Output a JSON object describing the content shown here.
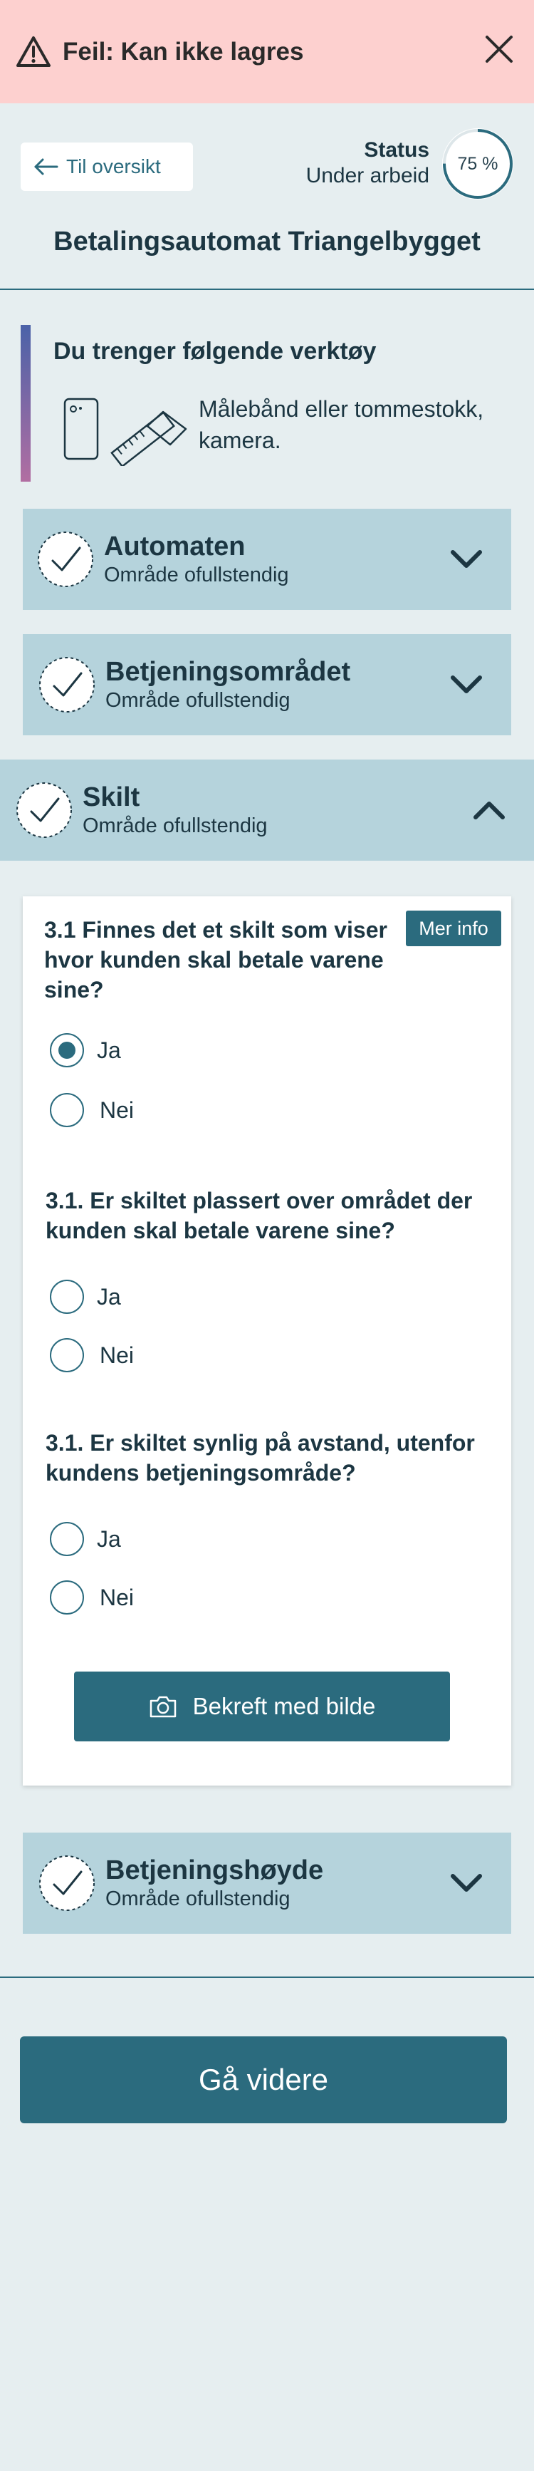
{
  "error": {
    "message": "Feil: Kan ikke lagres",
    "icon": "warning-icon",
    "close_icon": "close-icon"
  },
  "header": {
    "back_label": "Til oversikt",
    "status_label": "Status",
    "status_value": "Under arbeid",
    "progress_text": "75 %",
    "progress_fraction": 0.75,
    "title": "Betalingsautomat Triangelbygget"
  },
  "tools": {
    "heading": "Du trenger følgende verktøy",
    "description": "Målebånd eller tommestokk, kamera."
  },
  "sections": [
    {
      "title": "Automaten",
      "subtitle": "Område ofullstendig",
      "expanded": false
    },
    {
      "title": "Betjeningsområdet",
      "subtitle": "Område ofullstendig",
      "expanded": false
    },
    {
      "title": "Skilt",
      "subtitle": "Område ofullstendig",
      "expanded": true
    },
    {
      "title": "Betjeningshøyde",
      "subtitle": "Område ofullstendig",
      "expanded": false
    }
  ],
  "card": {
    "mer_info": "Mer info",
    "questions": [
      {
        "text": "3.1  Finnes det et skilt som viser hvor kunden skal betale varene sine?",
        "options": [
          "Ja",
          "Nei"
        ],
        "selected": "Ja"
      },
      {
        "text": "3.1. Er skiltet plassert over området der kunden skal betale varene sine?",
        "options": [
          "Ja",
          "Nei"
        ],
        "selected": null
      },
      {
        "text": "3.1. Er skiltet synlig på avstand, utenfor kundens betjeningsområde?",
        "options": [
          "Ja",
          "Nei"
        ],
        "selected": null
      }
    ],
    "confirm_label": "Bekreft med bilde"
  },
  "footer": {
    "continue_label": "Gå videre"
  },
  "colors": {
    "accent": "#2b6b7e",
    "section_bg": "#b5d3dc",
    "error_bg": "#fdd0cf",
    "page_bg": "#e6eef0"
  }
}
